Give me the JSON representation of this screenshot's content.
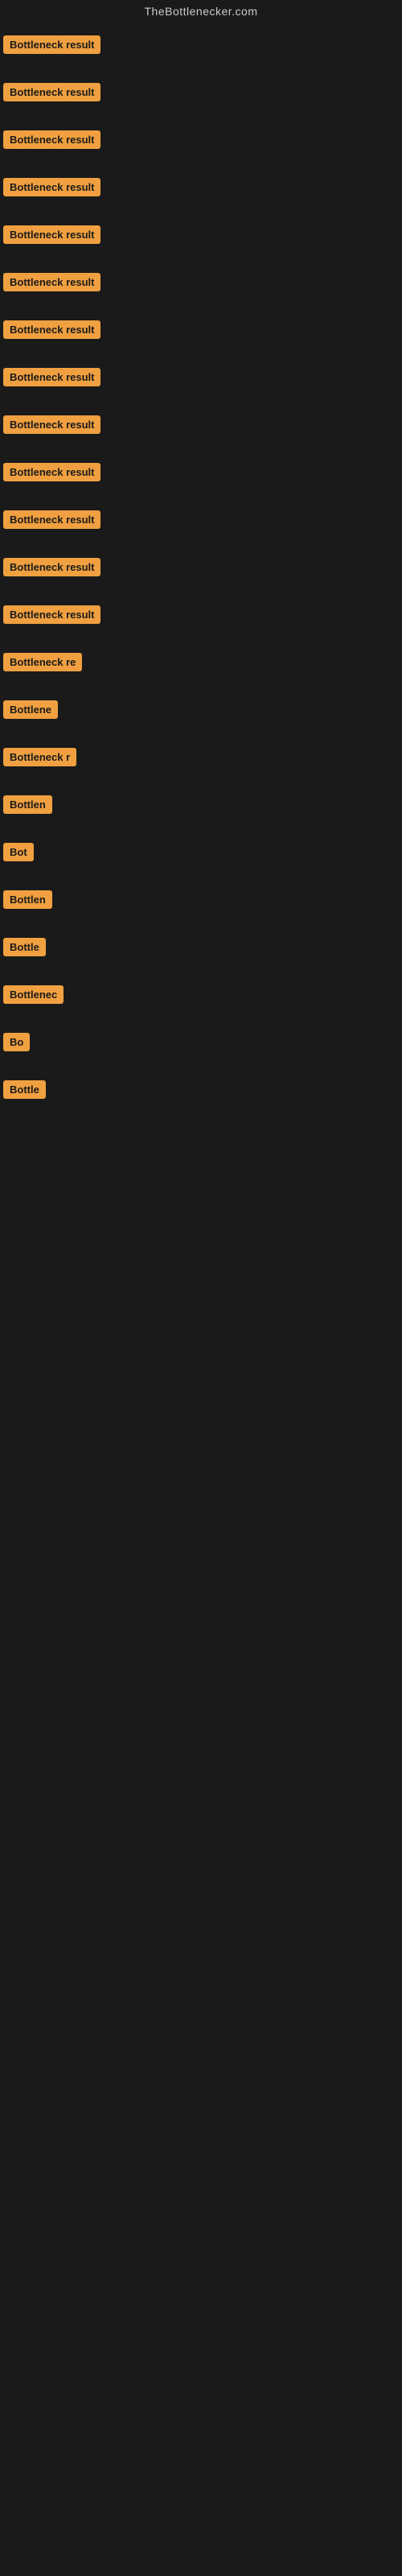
{
  "site": {
    "title": "TheBottlenecker.com"
  },
  "accent_color": "#f0a040",
  "rows": [
    {
      "id": 1,
      "label": "Bottleneck result",
      "width": "full"
    },
    {
      "id": 2,
      "label": "Bottleneck result",
      "width": "full"
    },
    {
      "id": 3,
      "label": "Bottleneck result",
      "width": "full"
    },
    {
      "id": 4,
      "label": "Bottleneck result",
      "width": "full"
    },
    {
      "id": 5,
      "label": "Bottleneck result",
      "width": "full"
    },
    {
      "id": 6,
      "label": "Bottleneck result",
      "width": "full"
    },
    {
      "id": 7,
      "label": "Bottleneck result",
      "width": "full"
    },
    {
      "id": 8,
      "label": "Bottleneck result",
      "width": "full"
    },
    {
      "id": 9,
      "label": "Bottleneck result",
      "width": "full"
    },
    {
      "id": 10,
      "label": "Bottleneck result",
      "width": "full"
    },
    {
      "id": 11,
      "label": "Bottleneck result",
      "width": "full"
    },
    {
      "id": 12,
      "label": "Bottleneck result",
      "width": "full"
    },
    {
      "id": 13,
      "label": "Bottleneck result",
      "width": "full"
    },
    {
      "id": 14,
      "label": "Bottleneck re",
      "width": "partial-lg"
    },
    {
      "id": 15,
      "label": "Bottlene",
      "width": "partial-md"
    },
    {
      "id": 16,
      "label": "Bottleneck r",
      "width": "partial-lg2"
    },
    {
      "id": 17,
      "label": "Bottlen",
      "width": "partial-sm2"
    },
    {
      "id": 18,
      "label": "Bot",
      "width": "partial-xs"
    },
    {
      "id": 19,
      "label": "Bottlen",
      "width": "partial-sm2"
    },
    {
      "id": 20,
      "label": "Bottle",
      "width": "partial-sm"
    },
    {
      "id": 21,
      "label": "Bottlenec",
      "width": "partial-md2"
    },
    {
      "id": 22,
      "label": "Bo",
      "width": "partial-xxs"
    },
    {
      "id": 23,
      "label": "Bottle",
      "width": "partial-sm"
    }
  ]
}
